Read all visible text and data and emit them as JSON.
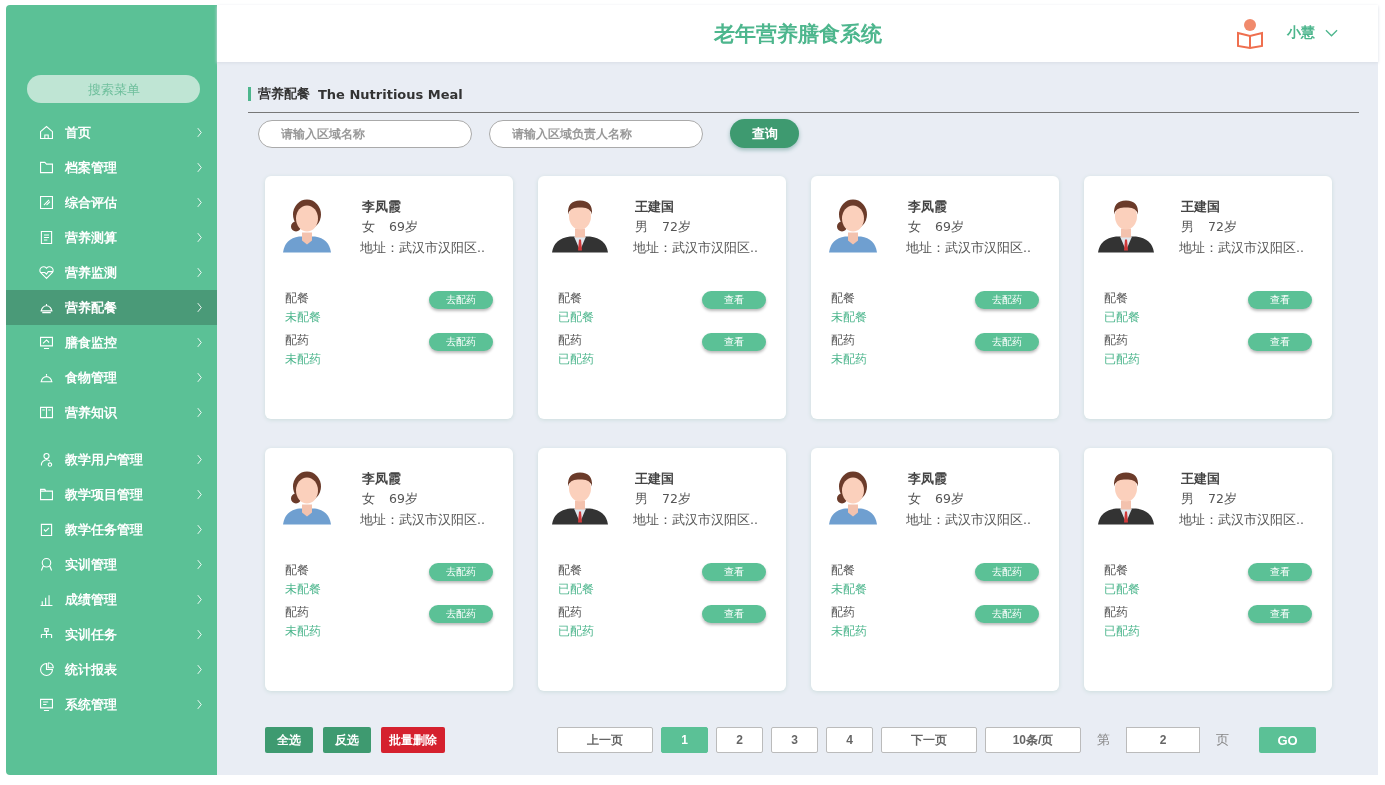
{
  "sidebar": {
    "search": {
      "placeholder": "搜索菜单"
    },
    "groups": [
      [
        {
          "label": "首页",
          "selected": false
        },
        {
          "label": "档案管理",
          "selected": false
        },
        {
          "label": "综合评估",
          "selected": false
        },
        {
          "label": "营养测算",
          "selected": false
        },
        {
          "label": "营养监测",
          "selected": false
        },
        {
          "label": "营养配餐",
          "selected": true
        },
        {
          "label": "膳食监控",
          "selected": false
        },
        {
          "label": "食物管理",
          "selected": false
        },
        {
          "label": "营养知识",
          "selected": false
        }
      ],
      [
        {
          "label": "教学用户管理",
          "selected": false
        },
        {
          "label": "教学项目管理",
          "selected": false
        },
        {
          "label": "教学任务管理",
          "selected": false
        },
        {
          "label": "实训管理",
          "selected": false
        },
        {
          "label": "成绩管理",
          "selected": false
        },
        {
          "label": "实训任务",
          "selected": false
        },
        {
          "label": "统计报表",
          "selected": false
        },
        {
          "label": "系统管理",
          "selected": false
        }
      ]
    ]
  },
  "header": {
    "title": "老年营养膳食系统",
    "user": "小慧"
  },
  "page": {
    "title": "营养配餐",
    "subtitle": "The Nutritious Meal"
  },
  "filters": {
    "region": {
      "placeholder": "请输入区域名称"
    },
    "manager": {
      "placeholder": "请输入区域负责人名称"
    },
    "query_button": "查询"
  },
  "cards": [
    {
      "kind": "female",
      "name": "李凤霞",
      "gender": "女",
      "age": "69岁",
      "address": "地址：武汉市汉阳区..",
      "meal_label": "配餐",
      "meal_status": "未配餐",
      "meal_button": "去配药",
      "med_label": "配药",
      "med_status": "未配药",
      "med_button": "去配药"
    },
    {
      "kind": "male",
      "name": "王建国",
      "gender": "男",
      "age": "72岁",
      "address": "地址：武汉市汉阳区..",
      "meal_label": "配餐",
      "meal_status": "已配餐",
      "meal_button": "查看",
      "med_label": "配药",
      "med_status": "已配药",
      "med_button": "查看"
    },
    {
      "kind": "female",
      "name": "李凤霞",
      "gender": "女",
      "age": "69岁",
      "address": "地址：武汉市汉阳区..",
      "meal_label": "配餐",
      "meal_status": "未配餐",
      "meal_button": "去配药",
      "med_label": "配药",
      "med_status": "未配药",
      "med_button": "去配药"
    },
    {
      "kind": "male",
      "name": "王建国",
      "gender": "男",
      "age": "72岁",
      "address": "地址：武汉市汉阳区..",
      "meal_label": "配餐",
      "meal_status": "已配餐",
      "meal_button": "查看",
      "med_label": "配药",
      "med_status": "已配药",
      "med_button": "查看"
    },
    {
      "kind": "female",
      "name": "李凤霞",
      "gender": "女",
      "age": "69岁",
      "address": "地址：武汉市汉阳区..",
      "meal_label": "配餐",
      "meal_status": "未配餐",
      "meal_button": "去配药",
      "med_label": "配药",
      "med_status": "未配药",
      "med_button": "去配药"
    },
    {
      "kind": "male",
      "name": "王建国",
      "gender": "男",
      "age": "72岁",
      "address": "地址：武汉市汉阳区..",
      "meal_label": "配餐",
      "meal_status": "已配餐",
      "meal_button": "查看",
      "med_label": "配药",
      "med_status": "已配药",
      "med_button": "查看"
    },
    {
      "kind": "female",
      "name": "李凤霞",
      "gender": "女",
      "age": "69岁",
      "address": "地址：武汉市汉阳区..",
      "meal_label": "配餐",
      "meal_status": "未配餐",
      "meal_button": "去配药",
      "med_label": "配药",
      "med_status": "未配药",
      "med_button": "去配药"
    },
    {
      "kind": "male",
      "name": "王建国",
      "gender": "男",
      "age": "72岁",
      "address": "地址：武汉市汉阳区..",
      "meal_label": "配餐",
      "meal_status": "已配餐",
      "meal_button": "查看",
      "med_label": "配药",
      "med_status": "已配药",
      "med_button": "查看"
    }
  ],
  "actions": [
    {
      "label": "全选",
      "kind": "normal"
    },
    {
      "label": "反选",
      "kind": "normal"
    },
    {
      "label": "批量删除",
      "kind": "danger"
    }
  ],
  "pagination": {
    "prev": "上一页",
    "pages": [
      {
        "label": "1",
        "selected": true
      },
      {
        "label": "2",
        "selected": false
      },
      {
        "label": "3",
        "selected": false
      },
      {
        "label": "4",
        "selected": false
      }
    ],
    "next": "下一页",
    "page_size": "10条/页",
    "goto_prefix": "第",
    "goto_value": "2",
    "goto_suffix": "页",
    "go_button": "GO"
  }
}
